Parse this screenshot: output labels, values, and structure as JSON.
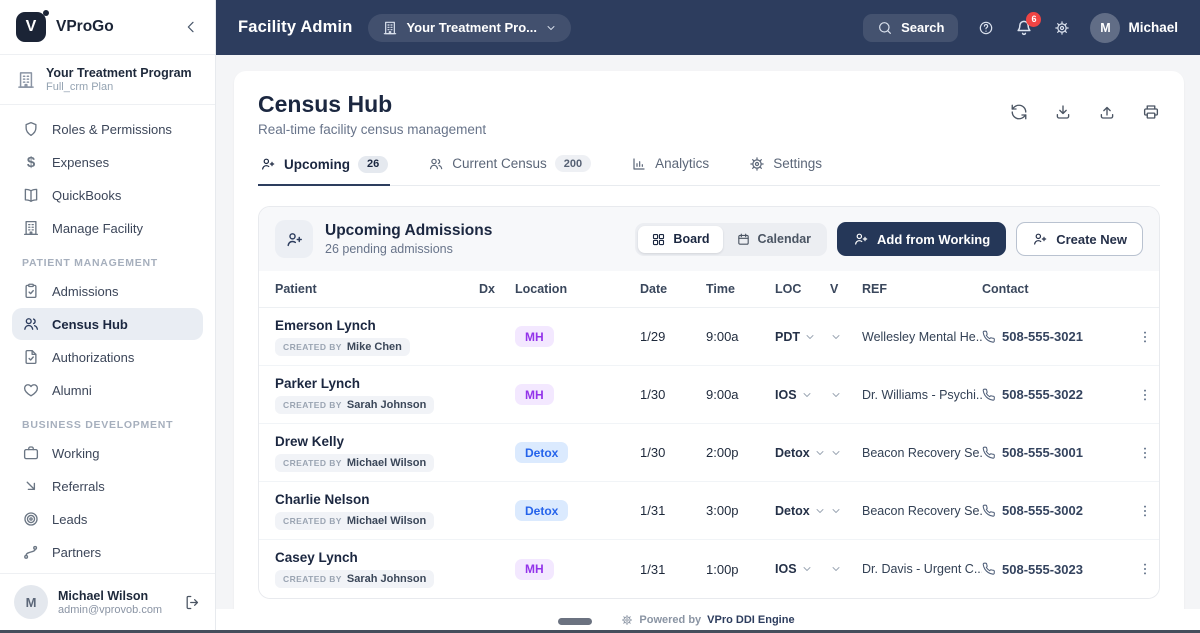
{
  "brand": {
    "name": "VProGo",
    "logo_letter": "V"
  },
  "topbar": {
    "title": "Facility Admin",
    "program_selector": "Your Treatment Pro...",
    "search_label": "Search",
    "notification_count": "6",
    "user_initial": "M",
    "user_name": "Michael"
  },
  "sidebar": {
    "program": {
      "name": "Your Treatment Program",
      "plan": "Full_crm Plan"
    },
    "sections": [
      {
        "heading": "",
        "items": [
          {
            "label": "Roles & Permissions",
            "icon": "shield"
          },
          {
            "label": "Expenses",
            "icon": "dollar"
          },
          {
            "label": "QuickBooks",
            "icon": "book"
          },
          {
            "label": "Manage Facility",
            "icon": "building"
          }
        ]
      },
      {
        "heading": "PATIENT MANAGEMENT",
        "items": [
          {
            "label": "Admissions",
            "icon": "clipboard"
          },
          {
            "label": "Census Hub",
            "icon": "users",
            "active": true
          },
          {
            "label": "Authorizations",
            "icon": "file-check"
          },
          {
            "label": "Alumni",
            "icon": "heart"
          }
        ]
      },
      {
        "heading": "BUSINESS DEVELOPMENT",
        "items": [
          {
            "label": "Working",
            "icon": "briefcase"
          },
          {
            "label": "Referrals",
            "icon": "arrow-down-right"
          },
          {
            "label": "Leads",
            "icon": "target"
          },
          {
            "label": "Partners",
            "icon": "branch"
          }
        ]
      }
    ],
    "user": {
      "initial": "M",
      "name": "Michael Wilson",
      "email": "admin@vprovob.com"
    }
  },
  "page": {
    "title": "Census Hub",
    "subtitle": "Real-time facility census management",
    "tabs": [
      {
        "label": "Upcoming",
        "badge": "26",
        "icon": "user-plus",
        "active": true
      },
      {
        "label": "Current Census",
        "badge": "200",
        "icon": "users",
        "active": false
      },
      {
        "label": "Analytics",
        "badge": "",
        "icon": "chart",
        "active": false
      },
      {
        "label": "Settings",
        "badge": "",
        "icon": "gear",
        "active": false
      }
    ],
    "tools": [
      "refresh",
      "download",
      "upload",
      "printer"
    ]
  },
  "panel": {
    "title": "Upcoming Admissions",
    "subtitle": "26 pending admissions",
    "view_toggle": [
      {
        "label": "Board",
        "icon": "grid",
        "active": true
      },
      {
        "label": "Calendar",
        "icon": "calendar",
        "active": false
      }
    ],
    "primary_action": "Add from Working",
    "secondary_action": "Create New"
  },
  "table": {
    "columns": [
      "Patient",
      "Dx",
      "Location",
      "Date",
      "Time",
      "LOC",
      "V",
      "REF",
      "Contact"
    ],
    "created_by_label": "CREATED BY",
    "rows": [
      {
        "patient": "Emerson Lynch",
        "created_by": "Mike Chen",
        "dx": "",
        "location": "MH",
        "location_variant": "purple",
        "date": "1/29",
        "time": "9:00a",
        "loc": "PDT",
        "ref": "Wellesley Mental He...",
        "contact": "508-555-3021"
      },
      {
        "patient": "Parker Lynch",
        "created_by": "Sarah Johnson",
        "dx": "",
        "location": "MH",
        "location_variant": "purple",
        "date": "1/30",
        "time": "9:00a",
        "loc": "IOS",
        "ref": "Dr. Williams - Psychi...",
        "contact": "508-555-3022"
      },
      {
        "patient": "Drew Kelly",
        "created_by": "Michael Wilson",
        "dx": "",
        "location": "Detox",
        "location_variant": "blue",
        "date": "1/30",
        "time": "2:00p",
        "loc": "Detox",
        "ref": "Beacon Recovery Se...",
        "contact": "508-555-3001"
      },
      {
        "patient": "Charlie Nelson",
        "created_by": "Michael Wilson",
        "dx": "",
        "location": "Detox",
        "location_variant": "blue",
        "date": "1/31",
        "time": "3:00p",
        "loc": "Detox",
        "ref": "Beacon Recovery Se...",
        "contact": "508-555-3002"
      },
      {
        "patient": "Casey Lynch",
        "created_by": "Sarah Johnson",
        "dx": "",
        "location": "MH",
        "location_variant": "purple",
        "date": "1/31",
        "time": "1:00p",
        "loc": "IOS",
        "ref": "Dr. Davis - Urgent C...",
        "contact": "508-555-3023"
      }
    ]
  },
  "footer": {
    "powered_by": "Powered by",
    "engine": "VPro DDI Engine"
  },
  "colors": {
    "topbar_navy": "#2d3d5e",
    "primary_button": "#253758",
    "notification_red": "#ef4444",
    "pill_mh_bg": "#f3e8ff",
    "pill_mh_text": "#9333ea",
    "pill_detox_bg": "#dbeafe",
    "pill_detox_text": "#2563eb",
    "active_nav_bg": "#e9edf3"
  }
}
